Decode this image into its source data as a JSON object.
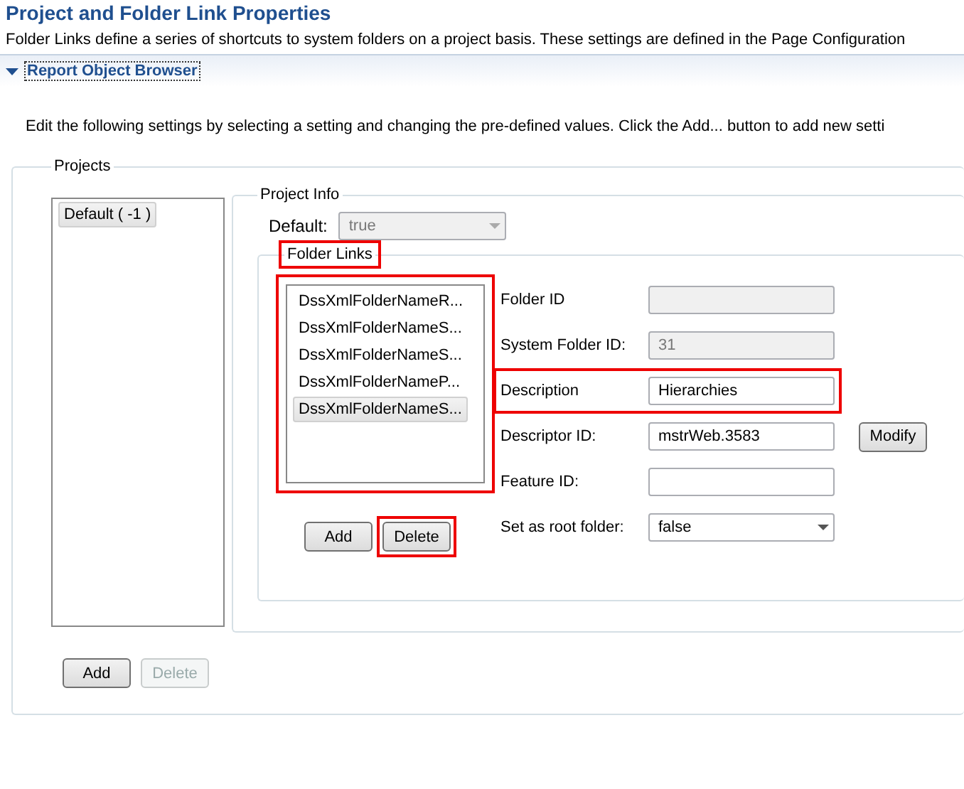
{
  "title": "Project and Folder Link Properties",
  "intro": "Folder Links define a series of shortcuts to system folders on a project basis. These settings are defined in the Page Configuration",
  "section": {
    "label": "Report Object Browser",
    "expanded": true
  },
  "instructions": "Edit the following settings by selecting a setting and changing the pre-defined values. Click the Add... button to add new setti",
  "projects": {
    "legend": "Projects",
    "items": [
      {
        "label": "Default ( -1 )",
        "selected": true
      }
    ],
    "buttons": [
      {
        "label": "Add",
        "disabled": false
      },
      {
        "label": "Delete",
        "disabled": true
      }
    ],
    "project_info": {
      "legend": "Project Info",
      "default_field": {
        "label": "Default:",
        "value": "true",
        "disabled": true
      },
      "folder_links": {
        "legend": "Folder Links",
        "highlighted": true,
        "list_highlighted": true,
        "items": [
          {
            "label": "DssXmlFolderNameR...",
            "selected": false
          },
          {
            "label": "DssXmlFolderNameS...",
            "selected": false
          },
          {
            "label": "DssXmlFolderNameS...",
            "selected": false
          },
          {
            "label": "DssXmlFolderNameP...",
            "selected": false
          },
          {
            "label": "DssXmlFolderNameS...",
            "selected": true
          }
        ],
        "buttons": [
          {
            "label": "Add",
            "highlighted": false
          },
          {
            "label": "Delete",
            "highlighted": true
          }
        ],
        "fields": [
          {
            "kind": "text",
            "label": "Folder ID",
            "disabled": true,
            "highlighted": false
          },
          {
            "kind": "text",
            "label": "System Folder ID:",
            "value": "31",
            "disabled": true,
            "highlighted": false
          },
          {
            "kind": "text",
            "label": "Description",
            "value": "Hierarchies",
            "disabled": false,
            "highlighted": true
          },
          {
            "kind": "text",
            "label": "Descriptor ID:",
            "value": "mstrWeb.3583",
            "disabled": false,
            "highlighted": false,
            "button": "Modify"
          },
          {
            "kind": "text",
            "label": "Feature ID:",
            "disabled": false,
            "highlighted": false
          },
          {
            "kind": "select",
            "label": "Set as root folder:",
            "value": "false",
            "disabled": false,
            "highlighted": false
          }
        ]
      }
    }
  }
}
